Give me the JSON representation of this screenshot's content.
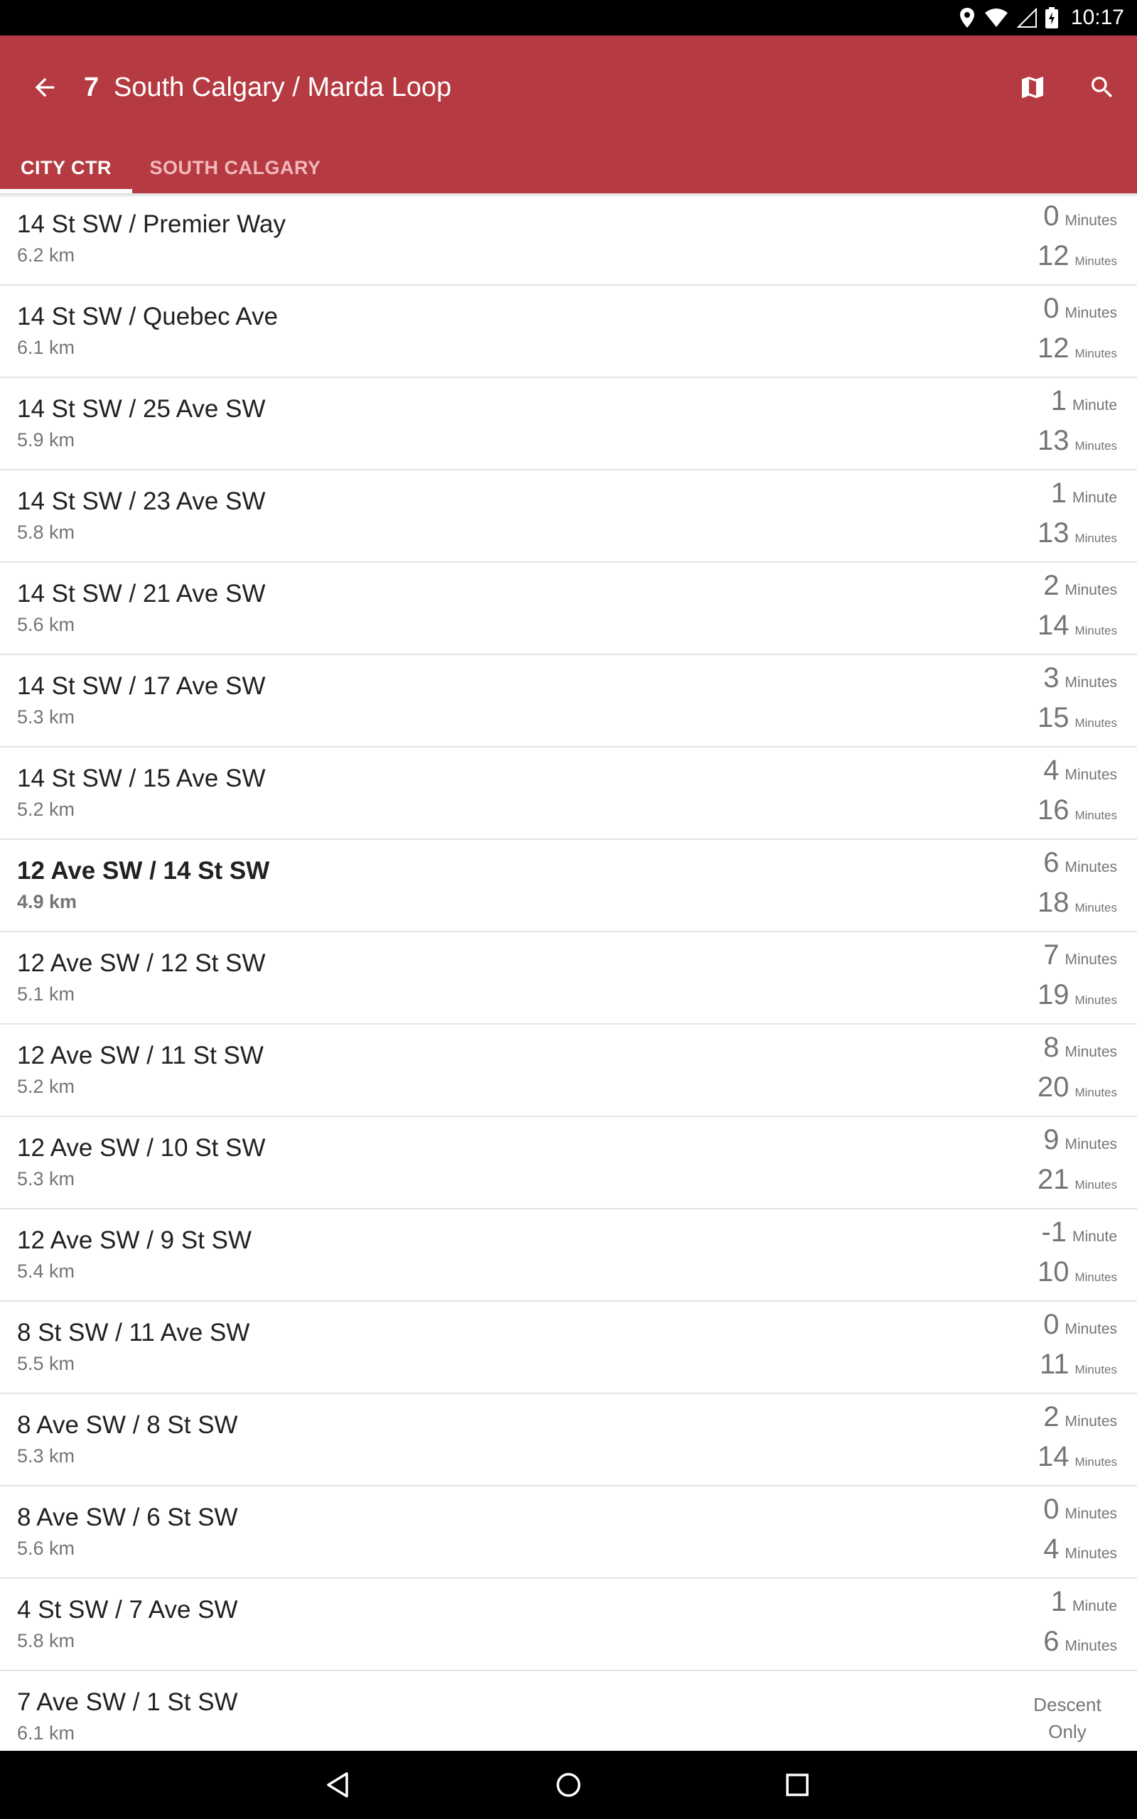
{
  "status_bar": {
    "time": "10:17"
  },
  "appbar": {
    "route_number": "7",
    "route_name": "South Calgary / Marda Loop",
    "accent_color": "#b63a41"
  },
  "tabs": [
    {
      "label": "CITY CTR",
      "selected": true
    },
    {
      "label": "SOUTH CALGARY",
      "selected": false
    }
  ],
  "stops": [
    {
      "name": "14 St SW / Premier Way",
      "distance": "6.2 km",
      "t1": "0",
      "u1": "Minutes",
      "t2": "12",
      "u2": "Minutes",
      "highlight": false
    },
    {
      "name": "14 St SW / Quebec Ave",
      "distance": "6.1 km",
      "t1": "0",
      "u1": "Minutes",
      "t2": "12",
      "u2": "Minutes",
      "highlight": false
    },
    {
      "name": "14 St SW / 25 Ave SW",
      "distance": "5.9 km",
      "t1": "1",
      "u1": "Minute",
      "t2": "13",
      "u2": "Minutes",
      "highlight": false
    },
    {
      "name": "14 St SW / 23 Ave SW",
      "distance": "5.8 km",
      "t1": "1",
      "u1": "Minute",
      "t2": "13",
      "u2": "Minutes",
      "highlight": false
    },
    {
      "name": "14 St SW / 21 Ave SW",
      "distance": "5.6 km",
      "t1": "2",
      "u1": "Minutes",
      "t2": "14",
      "u2": "Minutes",
      "highlight": false
    },
    {
      "name": "14 St SW / 17 Ave SW",
      "distance": "5.3 km",
      "t1": "3",
      "u1": "Minutes",
      "t2": "15",
      "u2": "Minutes",
      "highlight": false
    },
    {
      "name": "14 St SW / 15 Ave SW",
      "distance": "5.2 km",
      "t1": "4",
      "u1": "Minutes",
      "t2": "16",
      "u2": "Minutes",
      "highlight": false
    },
    {
      "name": "12 Ave SW / 14 St SW",
      "distance": "4.9 km",
      "t1": "6",
      "u1": "Minutes",
      "t2": "18",
      "u2": "Minutes",
      "highlight": true
    },
    {
      "name": "12 Ave SW / 12 St SW",
      "distance": "5.1 km",
      "t1": "7",
      "u1": "Minutes",
      "t2": "19",
      "u2": "Minutes",
      "highlight": false
    },
    {
      "name": "12 Ave SW / 11 St SW",
      "distance": "5.2 km",
      "t1": "8",
      "u1": "Minutes",
      "t2": "20",
      "u2": "Minutes",
      "highlight": false
    },
    {
      "name": "12 Ave SW / 10 St SW",
      "distance": "5.3 km",
      "t1": "9",
      "u1": "Minutes",
      "t2": "21",
      "u2": "Minutes",
      "highlight": false
    },
    {
      "name": "12 Ave SW / 9 St SW",
      "distance": "5.4 km",
      "t1": "-1",
      "u1": "Minute",
      "t2": "10",
      "u2": "Minutes",
      "highlight": false
    },
    {
      "name": "8 St SW / 11 Ave SW",
      "distance": "5.5 km",
      "t1": "0",
      "u1": "Minutes",
      "t2": "11",
      "u2": "Minutes",
      "highlight": false
    },
    {
      "name": "8 Ave SW / 8 St SW",
      "distance": "5.3 km",
      "t1": "2",
      "u1": "Minutes",
      "t2": "14",
      "u2": "Minutes",
      "highlight": false
    },
    {
      "name": "8 Ave SW / 6 St SW",
      "distance": "5.6 km",
      "t1": "0",
      "u1": "Minutes",
      "t2": "4",
      "u2": "Minutes",
      "highlight": false,
      "second_large_unit": true
    },
    {
      "name": "4 St SW / 7 Ave SW",
      "distance": "5.8 km",
      "t1": "1",
      "u1": "Minute",
      "t2": "6",
      "u2": "Minutes",
      "highlight": false,
      "second_large_unit": true
    },
    {
      "name": "7 Ave SW / 1 St SW",
      "distance": "6.1 km",
      "descent": "Descent Only",
      "highlight": false
    }
  ]
}
